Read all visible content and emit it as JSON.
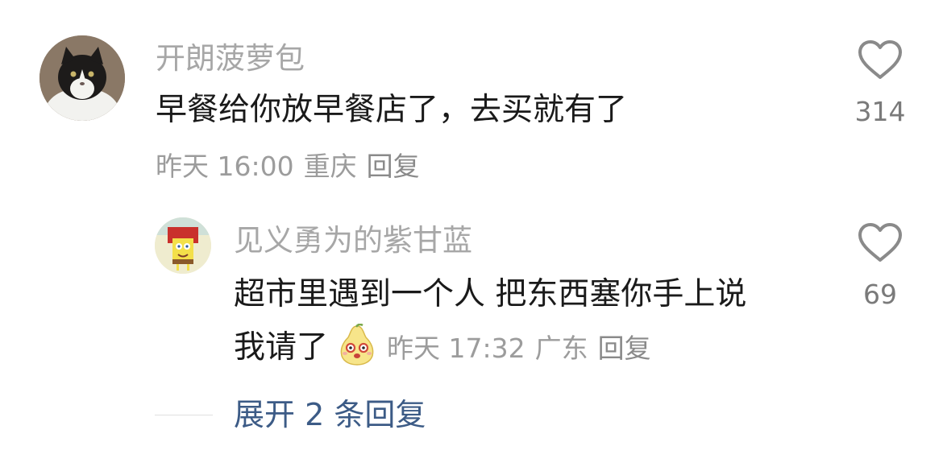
{
  "comment": {
    "username": "开朗菠萝包",
    "text": "早餐给你放早餐店了，去买就有了",
    "time": "昨天 16:00",
    "location": "重庆",
    "reply_label": "回复",
    "likes": "314",
    "avatar_icon": "cat-avatar"
  },
  "reply": {
    "username": "见义勇为的紫甘蓝",
    "text_line1": "超市里遇到一个人 把东西塞你手上说",
    "text_line2": "我请了",
    "emoji_icon": "pear-face-emoji",
    "time": "昨天 17:32",
    "location": "广东",
    "reply_label": "回复",
    "likes": "69",
    "avatar_icon": "spongebob-avatar"
  },
  "expand_label": "展开 2 条回复",
  "colors": {
    "username": "#a7a7a7",
    "text": "#1a1a1a",
    "meta": "#9c9c9c",
    "link": "#3c5b86",
    "heart": "#8a8a8a"
  }
}
